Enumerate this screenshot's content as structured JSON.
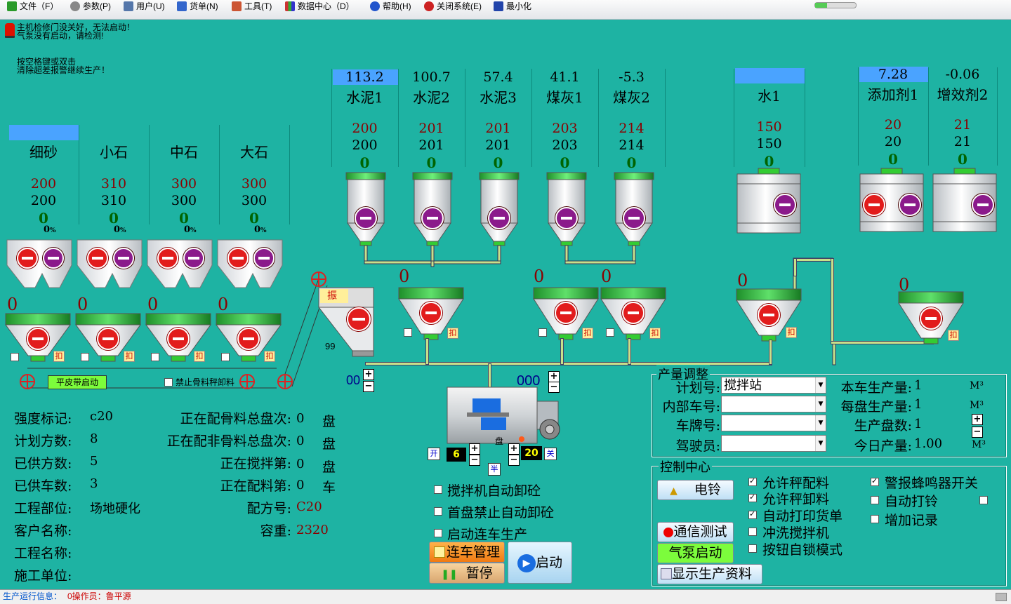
{
  "menu": [
    {
      "label": "文件（F）",
      "icon": "file-icon",
      "color": "#2a9a2a"
    },
    {
      "label": "参数(P)",
      "icon": "gear-icon",
      "color": "#888888"
    },
    {
      "label": "用户(U)",
      "icon": "users-icon",
      "color": "#5577aa"
    },
    {
      "label": "货单(N)",
      "icon": "edit-icon",
      "color": "#3366cc"
    },
    {
      "label": "工具(T)",
      "icon": "tool-icon",
      "color": "#cc5533"
    },
    {
      "label": "数据中心（D）",
      "icon": "chart-icon",
      "color": "#cc3333"
    },
    {
      "label": "帮助(H)",
      "icon": "help-icon",
      "color": "#2255cc"
    },
    {
      "label": "关闭系统(E)",
      "icon": "close-icon",
      "color": "#cc2222"
    },
    {
      "label": "最小化",
      "icon": "minimize-icon",
      "color": "#2244aa"
    }
  ],
  "alerts": {
    "line1": "主机检修门没关好，无法启动！",
    "line2": "气泵没有启动，请检测!",
    "hint1": "按空格键或双击",
    "hint2": "清除超差报警继续生产！"
  },
  "aggregates": [
    {
      "name": "细砂",
      "set": "200",
      "actual": "200",
      "weight": "0",
      "pct": "0",
      "pct_unit": "%",
      "bin_weight": "0",
      "highlight": true
    },
    {
      "name": "小石",
      "set": "310",
      "actual": "310",
      "weight": "0",
      "pct": "0",
      "pct_unit": "%",
      "bin_weight": "0",
      "highlight": false
    },
    {
      "name": "中石",
      "set": "300",
      "actual": "300",
      "weight": "0",
      "pct": "0",
      "pct_unit": "%",
      "bin_weight": "0",
      "highlight": false
    },
    {
      "name": "大石",
      "set": "300",
      "actual": "300",
      "weight": "0",
      "pct": "0",
      "pct_unit": "%",
      "bin_weight": "0",
      "highlight": false
    }
  ],
  "powders": [
    {
      "name": "水泥1",
      "value": "113.2",
      "set": "200",
      "actual": "200",
      "weight": "0",
      "highlight": true
    },
    {
      "name": "水泥2",
      "value": "100.7",
      "set": "201",
      "actual": "201",
      "weight": "0",
      "highlight": false
    },
    {
      "name": "水泥3",
      "value": "57.4",
      "set": "201",
      "actual": "201",
      "weight": "0",
      "highlight": false
    },
    {
      "name": "煤灰1",
      "value": "41.1",
      "set": "203",
      "actual": "203",
      "weight": "0",
      "highlight": false
    },
    {
      "name": "煤灰2",
      "value": "-5.3",
      "set": "214",
      "actual": "214",
      "weight": "0",
      "highlight": false
    }
  ],
  "water": {
    "name": "水1",
    "value": "",
    "set": "150",
    "actual": "150",
    "weight": "0"
  },
  "additives": [
    {
      "name": "添加剂1",
      "value": "7.28",
      "set": "20",
      "actual": "20",
      "weight": "0",
      "highlight": true
    },
    {
      "name": "增效剂2",
      "value": "-0.06",
      "set": "21",
      "actual": "21",
      "weight": "0",
      "highlight": false
    }
  ],
  "hoppers": {
    "cement_a": "0",
    "cement_b": "0",
    "cement_c": "0",
    "water": "0",
    "additive": "0",
    "kou": "扣",
    "zhen": "振",
    "incline_count": "99",
    "belt_count": "00",
    "mixer_count": "000"
  },
  "belt": {
    "start_label": "平皮带启动",
    "stop_label": "禁止骨料秤卸料"
  },
  "mixer": {
    "open": "开",
    "half": "半",
    "close": "关",
    "left_count": "6",
    "right_count": "20",
    "plate": "盘"
  },
  "info": {
    "rows": [
      {
        "label": "强度标记:",
        "value": "c20"
      },
      {
        "label": "计划方数:",
        "value": "8"
      },
      {
        "label": "已供方数:",
        "value": "5"
      },
      {
        "label": "已供车数:",
        "value": "3"
      },
      {
        "label": "工程部位:",
        "value": "场地硬化"
      },
      {
        "label": "客户名称:",
        "value": ""
      },
      {
        "label": "工程名称:",
        "value": ""
      },
      {
        "label": "施工单位:",
        "value": ""
      }
    ],
    "right": [
      {
        "label": "正在配骨料总盘次:",
        "value": "0",
        "unit": "盘"
      },
      {
        "label": "正在配非骨料总盘次:",
        "value": "0",
        "unit": "盘"
      },
      {
        "label": "正在搅拌第:",
        "value": "0",
        "unit": "盘"
      },
      {
        "label": "正在配料第:",
        "value": "0",
        "unit": "车"
      }
    ],
    "recipe_label": "配方号:",
    "recipe": "C20",
    "density_label": "容重:",
    "density": "2320"
  },
  "mixer_options": [
    {
      "label": "搅拌机自动卸砼",
      "checked": false
    },
    {
      "label": "首盘禁止自动卸砼",
      "checked": false
    },
    {
      "label": "启动连车生产",
      "checked": false
    }
  ],
  "buttons": {
    "queue": "连车管理",
    "pause": "暂停",
    "start": "启动"
  },
  "production": {
    "title": "产量调整",
    "plan_label": "计划号:",
    "plan_value": "搅拌站",
    "car_label": "内部车号:",
    "plate_label": "车牌号:",
    "driver_label": "驾驶员:",
    "car_output_label": "本车生产量:",
    "car_output": "1",
    "per_plate_label": "每盘生产量:",
    "per_plate": "1",
    "plates_label": "生产盘数:",
    "plates": "1",
    "today_label": "今日产量:",
    "today": "1.00",
    "unit": "M³"
  },
  "control": {
    "title": "控制中心",
    "bell": "电铃",
    "comm_test": "通信测试",
    "air_pump": "气泵启动",
    "show_data": "显示生产资料",
    "options_mid": [
      {
        "label": "允许秤配料",
        "checked": true
      },
      {
        "label": "允许秤卸料",
        "checked": true
      },
      {
        "label": "自动打印货单",
        "checked": true
      },
      {
        "label": "冲洗搅拌机",
        "checked": false
      },
      {
        "label": "按钮自锁模式",
        "checked": false
      }
    ],
    "options_right": [
      {
        "label": "警报蜂鸣器开关",
        "checked": true
      },
      {
        "label": "自动打铃",
        "checked": false
      },
      {
        "label": "增加记录",
        "checked": false
      }
    ]
  },
  "status": {
    "label": "生产运行信息：",
    "operator": "0操作员：鲁平源"
  }
}
